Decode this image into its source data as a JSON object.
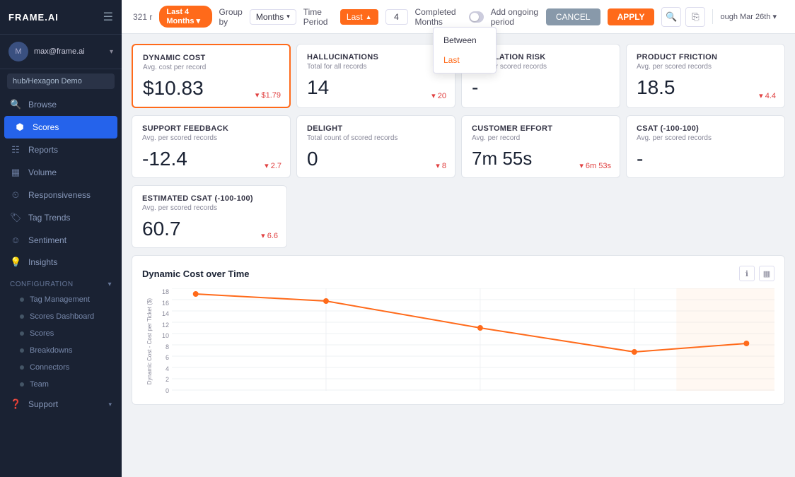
{
  "app": {
    "title": "FRAME.AI",
    "menu_icon": "≡"
  },
  "sidebar": {
    "user": {
      "email": "max@frame.ai",
      "avatar_initials": "M"
    },
    "org": "hub/Hexagon Demo",
    "nav_items": [
      {
        "id": "browse",
        "label": "Browse",
        "icon": "🔍"
      },
      {
        "id": "scores",
        "label": "Scores",
        "icon": "⬡",
        "active": true
      },
      {
        "id": "reports",
        "label": "Reports",
        "icon": "📊"
      },
      {
        "id": "volume",
        "label": "Volume",
        "icon": "📈"
      },
      {
        "id": "responsiveness",
        "label": "Responsiveness",
        "icon": "⏱"
      },
      {
        "id": "tag-trends",
        "label": "Tag Trends",
        "icon": "🏷"
      },
      {
        "id": "sentiment",
        "label": "Sentiment",
        "icon": "😊"
      },
      {
        "id": "insights",
        "label": "Insights",
        "icon": "💡"
      }
    ],
    "configuration": {
      "label": "Configuration",
      "sub_items": [
        {
          "id": "tag-management",
          "label": "Tag Management"
        },
        {
          "id": "scores-dashboard",
          "label": "Scores Dashboard"
        },
        {
          "id": "scores",
          "label": "Scores"
        },
        {
          "id": "breakdowns",
          "label": "Breakdowns"
        },
        {
          "id": "connectors",
          "label": "Connectors"
        },
        {
          "id": "team",
          "label": "Team"
        }
      ]
    },
    "support": {
      "label": "Support"
    }
  },
  "topbar": {
    "record_count": "321 r",
    "group_by_label": "Group by",
    "group_by_value": "Months",
    "time_period_label": "Time Period",
    "time_period_value": "Last",
    "number_value": "4",
    "completed_months_label": "Completed Months",
    "add_ongoing_label": "Add ongoing period",
    "cancel_label": "CANCEL",
    "apply_label": "APPLY",
    "date_range": "ough Mar 26th ▾",
    "filter_pill_label": "Last 4 Months ▾"
  },
  "dropdown": {
    "options": [
      {
        "id": "between",
        "label": "Between",
        "selected": false
      },
      {
        "id": "last",
        "label": "Last",
        "selected": true
      }
    ]
  },
  "cards": [
    {
      "id": "dynamic-cost",
      "title": "DYNAMIC COST",
      "subtitle": "Avg. cost per record",
      "value": "$10.83",
      "change": "▾ $1.79",
      "change_type": "down",
      "highlighted": true
    },
    {
      "id": "hallucinations",
      "title": "HALLUCINATIONS",
      "subtitle": "Total for all records",
      "value": "14",
      "change": "▾ 20",
      "change_type": "down",
      "highlighted": false
    },
    {
      "id": "escalation-risk",
      "title": "ESCALATION RISK",
      "subtitle": "Avg. per scored records",
      "value": "-",
      "change": "",
      "change_type": "",
      "highlighted": false
    },
    {
      "id": "product-friction",
      "title": "PRODUCT FRICTION",
      "subtitle": "Avg. per scored records",
      "value": "18.5",
      "change": "▾ 4.4",
      "change_type": "down",
      "highlighted": false
    },
    {
      "id": "support-feedback",
      "title": "SUPPORT FEEDBACK",
      "subtitle": "Avg. per scored records",
      "value": "-12.4",
      "change": "▾ 2.7",
      "change_type": "down",
      "highlighted": false
    },
    {
      "id": "delight",
      "title": "DELIGHT",
      "subtitle": "Total count of scored records",
      "value": "0",
      "change": "▾ 8",
      "change_type": "down",
      "highlighted": false
    },
    {
      "id": "customer-effort",
      "title": "CUSTOMER EFFORT",
      "subtitle": "Avg. per record",
      "value": "7m 55s",
      "change": "▾ 6m 53s",
      "change_type": "down",
      "highlighted": false
    },
    {
      "id": "csat",
      "title": "CSAT (-100-100)",
      "subtitle": "Avg. per scored records",
      "value": "-",
      "change": "",
      "change_type": "",
      "highlighted": false
    }
  ],
  "estimated_csat": {
    "title": "ESTIMATED CSAT (-100-100)",
    "subtitle": "Avg. per scored records",
    "value": "60.7",
    "change": "▾ 6.6",
    "change_type": "down"
  },
  "chart": {
    "title": "Dynamic Cost over Time",
    "y_axis_label": "Dynamic Cost - Cost per Ticket ($)",
    "y_ticks": [
      "18",
      "16",
      "14",
      "12",
      "10",
      "8",
      "6",
      "4",
      "2",
      "0"
    ],
    "data_points": [
      {
        "x": 0.04,
        "y": 0.08
      },
      {
        "x": 0.28,
        "y": 0.18
      },
      {
        "x": 0.52,
        "y": 0.42
      },
      {
        "x": 0.76,
        "y": 0.66
      },
      {
        "x": 0.96,
        "y": 0.58
      }
    ],
    "action_icons": [
      "ℹ",
      "⊞"
    ]
  }
}
